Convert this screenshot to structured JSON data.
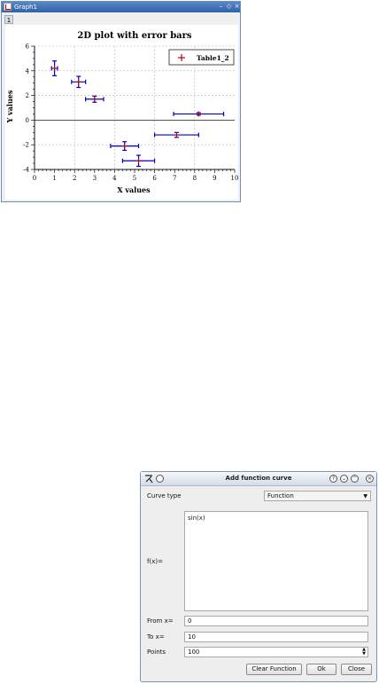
{
  "graph_window": {
    "title": "Graph1",
    "layer_tab": "1",
    "controls": {
      "minimize": "–",
      "restore": "◇",
      "close": "×"
    }
  },
  "chart_data": {
    "type": "scatter",
    "title": "2D plot with error bars",
    "xlabel": "X values",
    "ylabel": "Y values",
    "xlim": [
      0,
      10
    ],
    "ylim": [
      -4,
      6
    ],
    "x_ticks": [
      0,
      1,
      2,
      3,
      4,
      5,
      6,
      7,
      8,
      9,
      10
    ],
    "y_ticks": [
      -4,
      -2,
      0,
      2,
      4,
      6
    ],
    "grid": true,
    "legend_position": "top-right",
    "series": [
      {
        "name": "Table1_2",
        "marker_color": "#c00000",
        "errorbar_color": "#0000cc",
        "points": [
          {
            "x": 1.0,
            "y": 4.2,
            "xerr": 0.15,
            "yerr": 0.6
          },
          {
            "x": 2.2,
            "y": 3.1,
            "xerr": 0.35,
            "yerr": 0.45
          },
          {
            "x": 3.0,
            "y": 1.7,
            "xerr": 0.45,
            "yerr": 0.25
          },
          {
            "x": 4.5,
            "y": -2.1,
            "xerr": 0.7,
            "yerr": 0.35
          },
          {
            "x": 5.2,
            "y": -3.3,
            "xerr": 0.8,
            "yerr": 0.45
          },
          {
            "x": 7.1,
            "y": -1.2,
            "xerr": 1.1,
            "yerr": 0.2
          },
          {
            "x": 8.2,
            "y": 0.5,
            "xerr": 1.25,
            "yerr": 0.1
          }
        ]
      }
    ]
  },
  "dialog": {
    "title": "Add function curve",
    "help_icon": "?",
    "curve_type_label": "Curve type",
    "curve_type_value": "Function",
    "fx_label": "f(x)=",
    "function_text": "sin(x)",
    "from_label": "From x=",
    "from_value": "0",
    "to_label": "To x=",
    "to_value": "10",
    "points_label": "Points",
    "points_value": "100",
    "clear_button": "Clear Function",
    "ok_button": "Ok",
    "close_button": "Close"
  }
}
